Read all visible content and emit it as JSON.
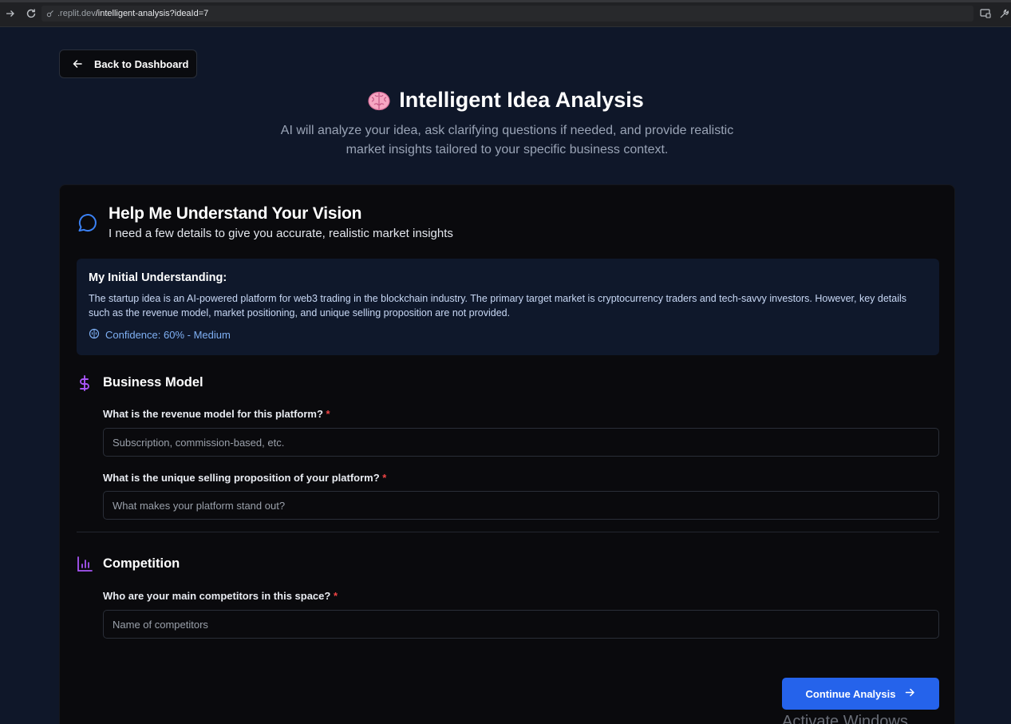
{
  "browser": {
    "url_host": ".replit.dev",
    "url_path": "/intelligent-analysis?ideaId=7"
  },
  "back_button": {
    "label": "Back to Dashboard"
  },
  "header": {
    "title": "Intelligent Idea Analysis",
    "subtitle": "AI will analyze your idea, ask clarifying questions if needed, and provide realistic market insights tailored to your specific business context."
  },
  "card": {
    "title": "Help Me Understand Your Vision",
    "subtitle": "I need a few details to give you accurate, realistic market insights",
    "understanding": {
      "heading": "My Initial Understanding:",
      "text": "The startup idea is an AI-powered platform for web3 trading in the blockchain industry. The primary target market is cryptocurrency traders and tech-savvy investors. However, key details such as the revenue model, market positioning, and unique selling proposition are not provided.",
      "confidence": "Confidence: 60% - Medium"
    },
    "sections": [
      {
        "title": "Business Model",
        "icon": "dollar-icon",
        "questions": [
          {
            "label": "What is the revenue model for this platform?",
            "required": "*",
            "value": "",
            "placeholder": "Subscription, commission-based, etc."
          },
          {
            "label": "What is the unique selling proposition of your platform?",
            "required": "*",
            "value": "",
            "placeholder": "What makes your platform stand out?"
          }
        ]
      },
      {
        "title": "Competition",
        "icon": "bar-chart-icon",
        "questions": [
          {
            "label": "Who are your main competitors in this space?",
            "required": "*",
            "value": "",
            "placeholder": "Name of competitors"
          }
        ]
      }
    ],
    "continue_label": "Continue Analysis"
  },
  "watermark": "Activate Windows",
  "colors": {
    "page_bg": "#0f1729",
    "card_bg": "#0a0a0d",
    "accent": "#2563eb",
    "section_icon": "#a855f7",
    "chat_icon": "#3b82f6",
    "required": "#ef4444",
    "confidence": "#7fb0f4"
  }
}
